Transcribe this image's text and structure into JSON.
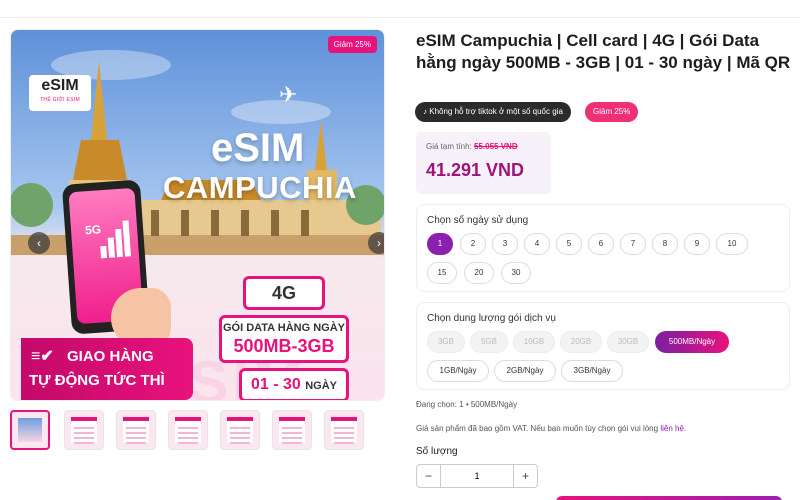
{
  "gallery": {
    "discount_tag": "Giảm 25%",
    "logo_main": "eSIM",
    "logo_sub": "THẾ GIỚI ESIM",
    "hero_line1": "eSIM",
    "hero_line2": "CAMPUCHIA",
    "card_network": "4G",
    "card_data_title": "GÓI DATA HÀNG NGÀY",
    "card_data_value": "500MB-3GB",
    "card_days_value": "01 - 30",
    "card_days_unit": "NGÀY",
    "delivery_line1": "GIAO HÀNG",
    "delivery_line2": "TỰ ĐỘNG TỨC THÌ",
    "phone_5g": "5G",
    "watermark": "eSIM",
    "prev_icon": "‹",
    "next_icon": "›",
    "thumbnail_count": 7
  },
  "product": {
    "title": "eSIM Campuchia | Cell card | 4G | Gói Data hằng ngày 500MB - 3GB | 01 - 30 ngày | Mã QR",
    "badge_tiktok": "Không hỗ trợ tiktok ở một số quốc gia",
    "badge_tiktok_icon": "♪",
    "badge_sale": "Giảm 25%",
    "price_label": "Giá tạm tính:",
    "price_old": "55.055 VND",
    "price_new": "41.291 VND"
  },
  "days": {
    "label": "Chọn số ngày sử dụng",
    "options": [
      "1",
      "2",
      "3",
      "4",
      "5",
      "6",
      "7",
      "8",
      "9",
      "10",
      "15",
      "20",
      "30"
    ],
    "selected": "1"
  },
  "data_package": {
    "label": "Chọn dung lượng gói dịch vụ",
    "options": [
      "3GB",
      "5GB",
      "10GB",
      "20GB",
      "30GB",
      "500MB/Ngày",
      "1GB/Ngày",
      "2GB/Ngày",
      "3GB/Ngày"
    ],
    "disabled": [
      "3GB",
      "5GB",
      "10GB",
      "20GB",
      "30GB"
    ],
    "selected": "500MB/Ngày"
  },
  "selection_summary": "Đang chọn: 1 • 500MB/Ngày",
  "vat_note": "Giá sản phẩm đã bao gồm VAT. Nếu bạn muốn tùy chọn gói vui lòng",
  "vat_link": "liên hệ.",
  "quantity": {
    "label": "Số lượng",
    "value": "1",
    "minus": "−",
    "plus": "+"
  },
  "colors": {
    "brand_pink": "#e8127c",
    "brand_purple": "#8a1fb0",
    "price_color": "#a0137a"
  }
}
